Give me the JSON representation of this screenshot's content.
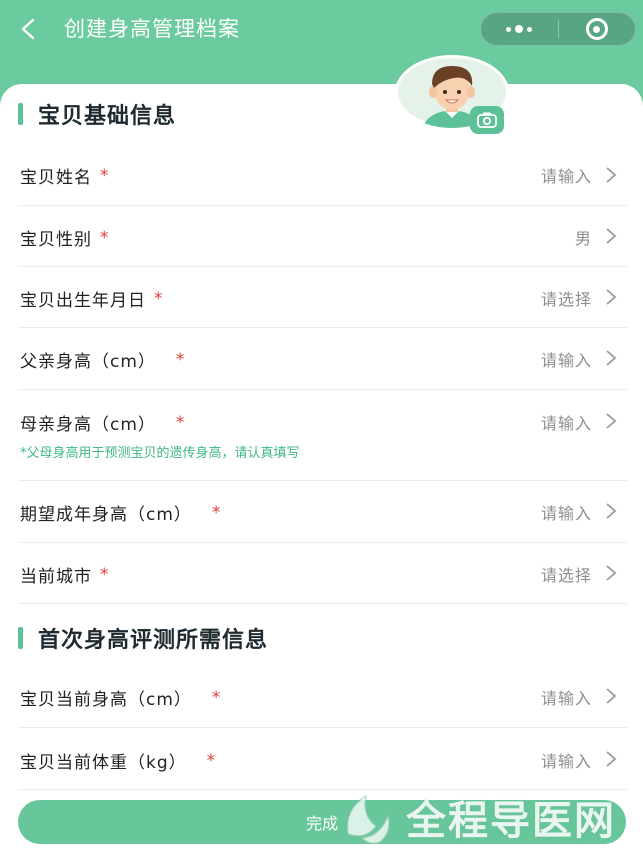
{
  "header": {
    "title": "创建身高管理档案"
  },
  "sections": {
    "basic": {
      "title": "宝贝基础信息"
    },
    "first": {
      "title": "首次身高评测所需信息"
    }
  },
  "fields": {
    "name": {
      "label": "宝贝姓名",
      "required": "*",
      "value": "请输入"
    },
    "gender": {
      "label": "宝贝性别",
      "required": "*",
      "value": "男"
    },
    "birthday": {
      "label": "宝贝出生年月日",
      "required": "*",
      "value": "请选择"
    },
    "father_height": {
      "label": "父亲身高（cm）",
      "required": "*",
      "value": "请输入"
    },
    "mother_height": {
      "label": "母亲身高（cm）",
      "required": "*",
      "value": "请输入"
    },
    "expected_height": {
      "label": "期望成年身高（cm）",
      "required": "*",
      "value": "请输入"
    },
    "city": {
      "label": "当前城市",
      "required": "*",
      "value": "请选择"
    },
    "current_height": {
      "label": "宝贝当前身高（cm）",
      "required": "*",
      "value": "请输入"
    },
    "current_weight": {
      "label": "宝贝当前体重（kg）",
      "required": "*",
      "value": "请输入"
    }
  },
  "hint": "*父母身高用于预测宝贝的遗传身高，请认真填写",
  "submit_label": "完成",
  "watermark": "全程导医网",
  "colors": {
    "primary": "#6ccb9e",
    "required": "#e23c3c",
    "hint": "#3fb882"
  },
  "icons": {
    "back": "chevron-left-icon",
    "more": "more-dots-icon",
    "close": "target-circle-icon",
    "camera": "camera-icon",
    "arrow": "chevron-right-icon"
  }
}
